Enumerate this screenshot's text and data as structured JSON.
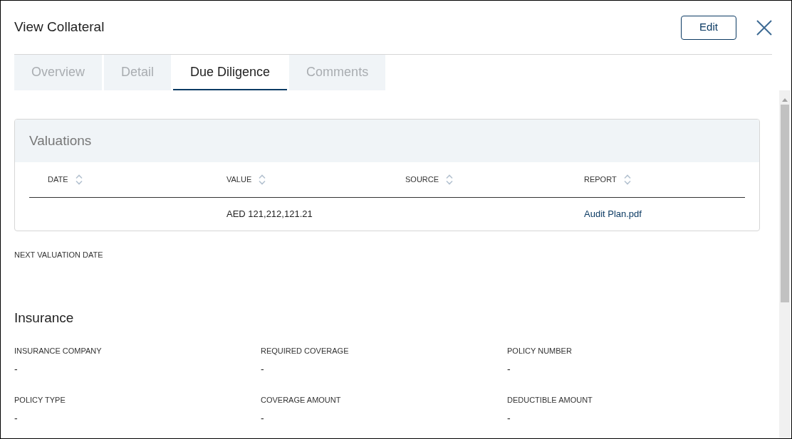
{
  "window": {
    "title": "View Collateral",
    "edit_button": "Edit"
  },
  "tabs": [
    {
      "label": "Overview",
      "selected": false
    },
    {
      "label": "Detail",
      "selected": false
    },
    {
      "label": "Due Diligence",
      "selected": true
    },
    {
      "label": "Comments",
      "selected": false
    }
  ],
  "valuations": {
    "title": "Valuations",
    "columns": [
      {
        "label": "DATE"
      },
      {
        "label": "VALUE"
      },
      {
        "label": "SOURCE"
      },
      {
        "label": "REPORT"
      }
    ],
    "rows": [
      {
        "cells": [
          null,
          {
            "text": "AED 121,212,121.21",
            "kind": "text"
          },
          null,
          {
            "text": "Audit Plan.pdf",
            "kind": "link"
          }
        ]
      }
    ]
  },
  "next_valuation": {
    "label": "NEXT VALUATION DATE"
  },
  "insurance": {
    "title": "Insurance",
    "fields": [
      {
        "label": "INSURANCE COMPANY",
        "value": "-"
      },
      {
        "label": "REQUIRED COVERAGE",
        "value": "-"
      },
      {
        "label": "POLICY NUMBER",
        "value": "-"
      },
      {
        "label": "POLICY TYPE",
        "value": "-"
      },
      {
        "label": "COVERAGE AMOUNT",
        "value": "-"
      },
      {
        "label": "DEDUCTIBLE AMOUNT",
        "value": "-"
      }
    ]
  }
}
